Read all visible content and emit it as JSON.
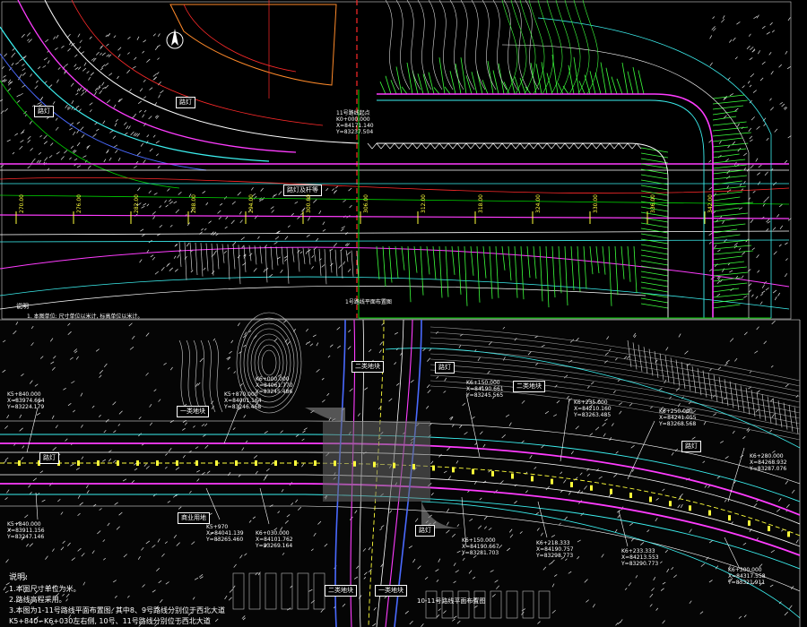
{
  "top_panel": {
    "labels": {
      "box_a": "路灯",
      "box_b": "路灯",
      "box_center": "路灯及杆等",
      "caption": "1号路线平面布置图",
      "note_title": "说明",
      "note_1": "1. 本图单位: 尺寸单位以米计, 标高单位以米计。"
    },
    "stations": [
      "270.00",
      "276.00",
      "282.00",
      "288.00",
      "294.00",
      "300.00",
      "306.00",
      "312.00",
      "318.00",
      "324.00",
      "330.00",
      "336.00",
      "342.00"
    ],
    "coord_text": [
      "11号路线起点",
      "K0+000.000",
      "X=84171.140",
      "Y=83237.504"
    ]
  },
  "bottom_panel": {
    "boxes": {
      "b1": "一类地块",
      "b2": "二类地块",
      "b3": "路灯",
      "b4": "二类地块",
      "b5": "路灯",
      "b6": "商业用地",
      "b7": "路灯",
      "b8": "二类地块",
      "b9": "一类地块",
      "b10": "路灯"
    },
    "coords": {
      "c1": [
        "K5+840.000",
        "X=83974.664",
        "Y=83224.179"
      ],
      "c2": [
        "K5+870.000",
        "X=84001.164",
        "Y=83246.468"
      ],
      "c3": [
        "K6+000.000",
        "X=84061.770",
        "Y=83245.486"
      ],
      "c4": [
        "K6+150.000",
        "X=84190.661",
        "Y=83245.565"
      ],
      "c5": [
        "K6+235.000",
        "X=84210.160",
        "Y=83263.485"
      ],
      "c6": [
        "K6+250.000",
        "X=84241.055",
        "Y=83268.568"
      ],
      "c7": [
        "K6+280.000",
        "X=84268.932",
        "Y=83287.076"
      ],
      "c8": [
        "K5+840.000",
        "X=83911.156",
        "Y=83247.146"
      ],
      "c9": [
        "K5+970",
        "X=84041.139",
        "Y=83265.460"
      ],
      "c10": [
        "K6+030.000",
        "X=84101.762",
        "Y=83269.164"
      ],
      "c11": [
        "K6+150.000",
        "X=84190.667",
        "Y=83281.703"
      ],
      "c12": [
        "K6+218.333",
        "X=84190.757",
        "Y=83298.773"
      ],
      "c13": [
        "K6+233.333",
        "X=84213.553",
        "Y=83290.773"
      ],
      "c14": [
        "K6+300.000",
        "X=84317.558",
        "Y=83321.911"
      ]
    },
    "caption": "10-11号路线平面布置图",
    "notes": {
      "title": "说明:",
      "n1": "1.本图尺寸单位为米。",
      "n2": "2.路线高程采用。",
      "n3": "3.本图为1-11号路线平面布置图, 其中8、9号路线分别位于西北大道",
      "n4": "K5+840~K6+030左右侧, 10号、11号路线分别位于西北大道"
    }
  },
  "colors": {
    "background": "#000000",
    "white": "#ffffff",
    "green": "#00d200",
    "bright_green": "#3cff3c",
    "cyan": "#3cf0f0",
    "magenta": "#ff3cff",
    "red": "#ff2a2a",
    "yellow": "#ffff3a",
    "blue": "#4a6aff",
    "orange": "#ff8a2a",
    "gray": "#8a8a8a"
  }
}
